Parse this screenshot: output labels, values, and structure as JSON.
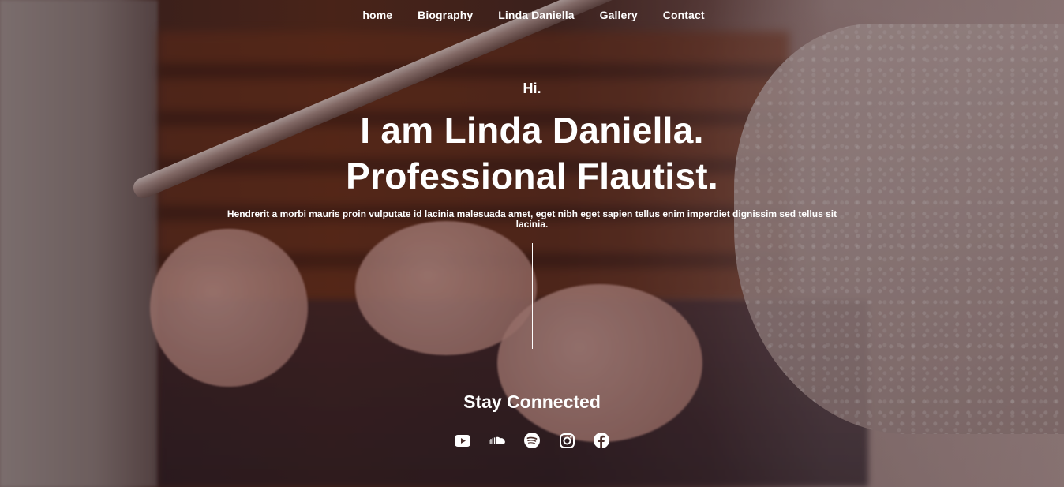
{
  "nav": {
    "items": [
      {
        "label": "home"
      },
      {
        "label": "Biography"
      },
      {
        "label": "Linda Daniella"
      },
      {
        "label": "Gallery"
      },
      {
        "label": "Contact"
      }
    ]
  },
  "hero": {
    "greeting": "Hi.",
    "headline_line1": "I am Linda Daniella.",
    "headline_line2": "Professional Flautist.",
    "description": "Hendrerit a morbi mauris proin vulputate id lacinia malesuada amet, eget nibh eget sapien tellus enim imperdiet dignissim sed tellus sit lacinia."
  },
  "social": {
    "heading": "Stay Connected",
    "icons": [
      "youtube-icon",
      "soundcloud-icon",
      "spotify-icon",
      "instagram-icon",
      "facebook-icon"
    ]
  },
  "colors": {
    "text": "#ffffff"
  }
}
